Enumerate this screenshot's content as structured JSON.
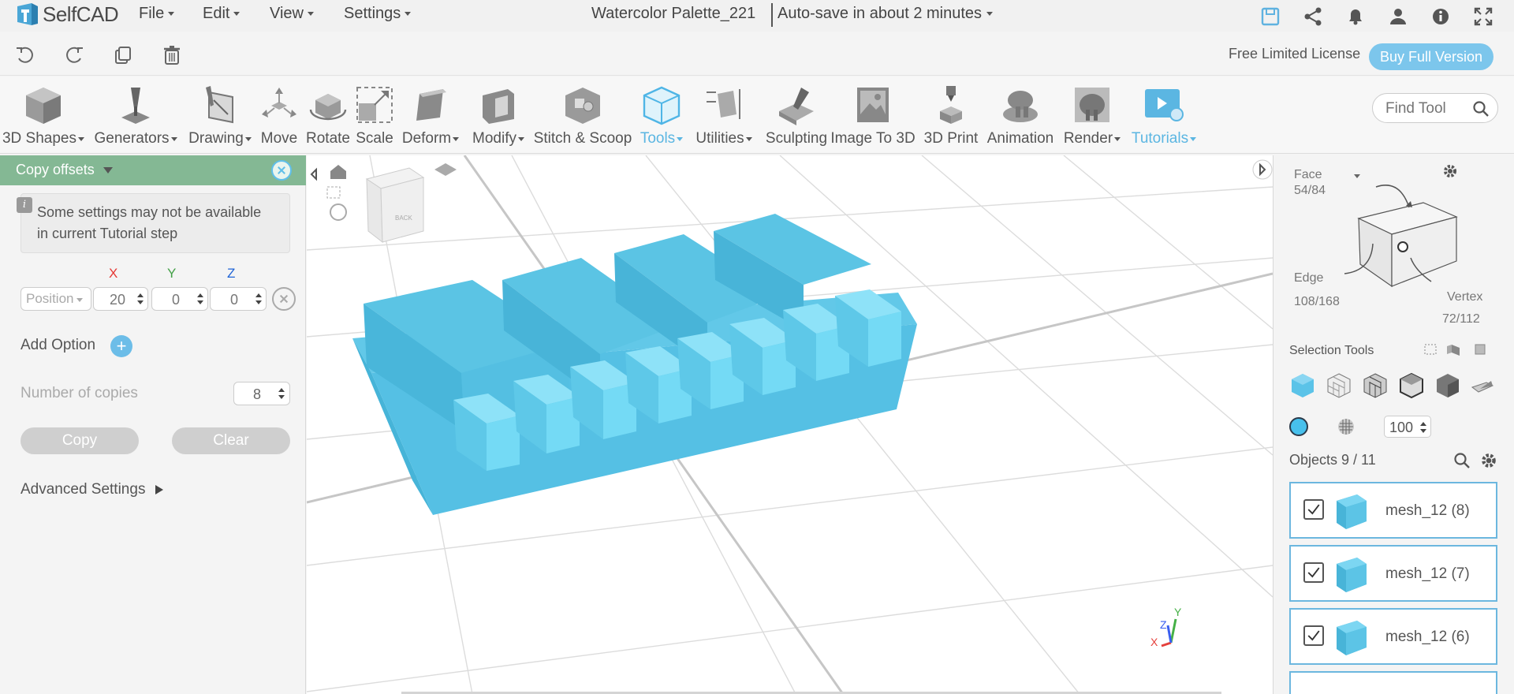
{
  "app": {
    "logo_text": "SelfCAD",
    "menus": [
      {
        "label": "File"
      },
      {
        "label": "Edit"
      },
      {
        "label": "View"
      },
      {
        "label": "Settings"
      }
    ],
    "doc_title": "Watercolor Palette_221",
    "autosave": "Auto-save in about 2 minutes",
    "top_icons": [
      "save-icon",
      "share-icon",
      "bell-icon",
      "user-icon",
      "info-icon",
      "fullscreen-icon"
    ]
  },
  "subbar": {
    "icons": [
      "undo-icon",
      "redo-icon",
      "copy-icon",
      "trash-icon"
    ],
    "license": "Free Limited License",
    "buy_button": "Buy Full Version"
  },
  "toolbar": {
    "tools": [
      {
        "label": "3D Shapes",
        "dropdown": true
      },
      {
        "label": "Generators",
        "dropdown": true
      },
      {
        "label": "Drawing",
        "dropdown": true
      },
      {
        "label": "Move",
        "dropdown": false
      },
      {
        "label": "Rotate",
        "dropdown": false
      },
      {
        "label": "Scale",
        "dropdown": false
      },
      {
        "label": "Deform",
        "dropdown": true
      },
      {
        "label": "Modify",
        "dropdown": true
      },
      {
        "label": "Stitch & Scoop",
        "dropdown": false
      },
      {
        "label": "Tools",
        "dropdown": true
      },
      {
        "label": "Utilities",
        "dropdown": true
      },
      {
        "label": "Sculpting",
        "dropdown": false
      },
      {
        "label": "Image To 3D",
        "dropdown": false
      },
      {
        "label": "3D Print",
        "dropdown": false
      },
      {
        "label": "Animation",
        "dropdown": false
      },
      {
        "label": "Render",
        "dropdown": true
      },
      {
        "label": "Tutorials",
        "dropdown": true
      }
    ],
    "find_tool_placeholder": "Find Tool"
  },
  "left_panel": {
    "title": "Copy offsets",
    "note": "Some settings may not be available in current Tutorial step",
    "axes": {
      "x": "X",
      "y": "Y",
      "z": "Z"
    },
    "position_select": "Position",
    "values": {
      "x": "20",
      "y": "0",
      "z": "0"
    },
    "add_option": "Add Option",
    "copies_label": "Number of copies",
    "copies_value": "8",
    "copy_button": "Copy",
    "clear_button": "Clear",
    "advanced": "Advanced Settings"
  },
  "viewport": {
    "view_cube_label": "BACK",
    "axis_labels": {
      "x": "X",
      "y": "Y",
      "z": "Z"
    },
    "colors": {
      "object": "#56c3e4",
      "object_light": "#74dcf6",
      "axis_x": "#e5403c",
      "axis_y": "#45b046",
      "axis_z": "#3a5ef0"
    }
  },
  "right_panel": {
    "face_label": "Face",
    "face_count": "54/84",
    "edge_label": "Edge",
    "edge_count": "108/168",
    "vertex_label": "Vertex",
    "vertex_count": "72/112",
    "selection_tools": "Selection Tools",
    "opacity": "100",
    "objects_label": "Objects 9 / 11",
    "objects": [
      {
        "name": "mesh_12 (8)",
        "checked": true
      },
      {
        "name": "mesh_12 (7)",
        "checked": true
      },
      {
        "name": "mesh_12 (6)",
        "checked": true
      }
    ]
  }
}
